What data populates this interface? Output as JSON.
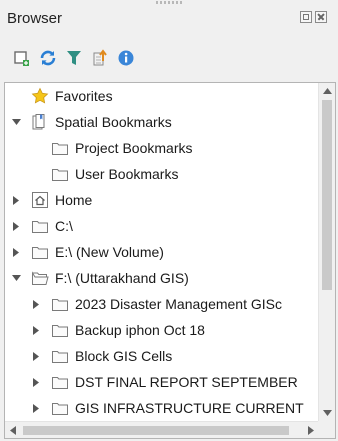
{
  "panel": {
    "title": "Browser",
    "float_button_icon": "float-icon",
    "close_button_icon": "close-icon"
  },
  "toolbar": {
    "buttons": [
      {
        "name": "add-layer",
        "icon": "add-layer-icon"
      },
      {
        "name": "refresh",
        "icon": "refresh-icon"
      },
      {
        "name": "filter",
        "icon": "filter-icon"
      },
      {
        "name": "collapse-all",
        "icon": "collapse-all-icon"
      },
      {
        "name": "properties",
        "icon": "info-icon"
      }
    ]
  },
  "tree": {
    "items": [
      {
        "label": "Favorites",
        "icon": "star-icon",
        "expander": "none",
        "level": 0
      },
      {
        "label": "Spatial Bookmarks",
        "icon": "bookmark-icon",
        "expander": "expanded",
        "level": 0
      },
      {
        "label": "Project Bookmarks",
        "icon": "folder-icon",
        "expander": "none",
        "level": 1
      },
      {
        "label": "User Bookmarks",
        "icon": "folder-icon",
        "expander": "none",
        "level": 1
      },
      {
        "label": "Home",
        "icon": "home-icon",
        "expander": "collapsed",
        "level": 0
      },
      {
        "label": "C:\\",
        "icon": "folder-icon",
        "expander": "collapsed",
        "level": 0
      },
      {
        "label": "E:\\ (New Volume)",
        "icon": "folder-icon",
        "expander": "collapsed",
        "level": 0
      },
      {
        "label": "F:\\ (Uttarakhand GIS)",
        "icon": "folder-open-icon",
        "expander": "expanded",
        "level": 0
      },
      {
        "label": "2023 Disaster Management GISc",
        "icon": "folder-icon",
        "expander": "collapsed",
        "level": 1
      },
      {
        "label": "Backup iphon Oct 18",
        "icon": "folder-icon",
        "expander": "collapsed",
        "level": 1
      },
      {
        "label": "Block GIS Cells",
        "icon": "folder-icon",
        "expander": "collapsed",
        "level": 1
      },
      {
        "label": "DST FINAL REPORT SEPTEMBER",
        "icon": "folder-icon",
        "expander": "collapsed",
        "level": 1
      },
      {
        "label": "GIS INFRASTRUCTURE CURRENT",
        "icon": "folder-icon",
        "expander": "collapsed",
        "level": 1
      }
    ]
  },
  "colors": {
    "panel_bg": "#f0f0f0",
    "tree_bg": "#ffffff",
    "refresh_blue": "#2a7fd4",
    "filter_teal": "#2f8f83",
    "folder_stroke": "#7a7a7a",
    "star_yellow": "#f5c518",
    "info_blue": "#3a86d8"
  }
}
